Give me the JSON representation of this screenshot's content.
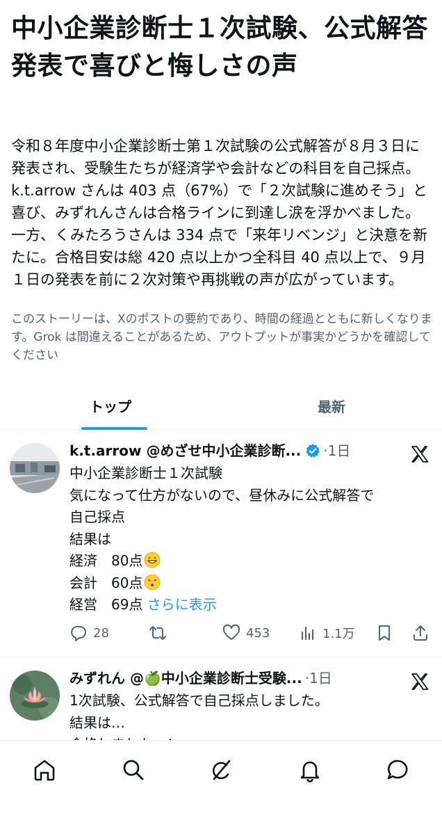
{
  "story": {
    "headline": "中小企業診断士１次試験、公式解答発表で喜びと悔しさの声",
    "summary": "令和８年度中小企業診断士第１次試験の公式解答が８月３日に発表され、受験生たちが経済学や会計などの科目を自己採点。k.t.arrow さんは 403 点（67%）で「２次試験に進めそう」と喜び、みずれんさんは合格ラインに到達し涙を浮かべました。一方、くみたろうさんは 334 点で「来年リベンジ」と決意を新たに。合格目安は総 420 点以上かつ全科目 40 点以上で、９月１日の発表を前に２次対策や再挑戦の声が広がっています。",
    "disclaimer": "このストーリーは、Xのポストの要約であり、時間の経過とともに新しくなります。Grok は間違えることがあるため、アウトプットが事実かどうかを確認してください"
  },
  "tabs": [
    {
      "label": "トップ",
      "active": true
    },
    {
      "label": "最新",
      "active": false
    }
  ],
  "posts": [
    {
      "name": "k.t.arrow @めざせ中小企業診断...",
      "time": "·1日",
      "verified": true,
      "lines": [
        "中小企業診断士１次試験",
        "気になって仕方がないので、昼休みに公式解答で",
        "自己採点",
        "結果は",
        "経済　80点",
        "会計　60点",
        "経営　69点 "
      ],
      "line_emojis": [
        "",
        "",
        "",
        "",
        "grinning-face-emoji",
        "anxious-sweat-face-emoji",
        ""
      ],
      "more_label": "さらに表示",
      "replies": "28",
      "reposts": "",
      "likes": "453",
      "views": "1.1万"
    },
    {
      "name": "みずれん @🍏中小企業診断士受験...",
      "time": "·1日",
      "verified": false,
      "lines": [
        "1次試験、公式解答で自己採点しました。",
        "結果は…",
        "合格しましたー！"
      ]
    }
  ],
  "nav": [
    "home-icon",
    "search-icon",
    "grok-icon",
    "notifications-icon",
    "messages-icon"
  ],
  "colors": {
    "accent": "#1d9bf0",
    "text": "#0f1419",
    "muted": "#536471",
    "divider": "#eff3f4"
  }
}
